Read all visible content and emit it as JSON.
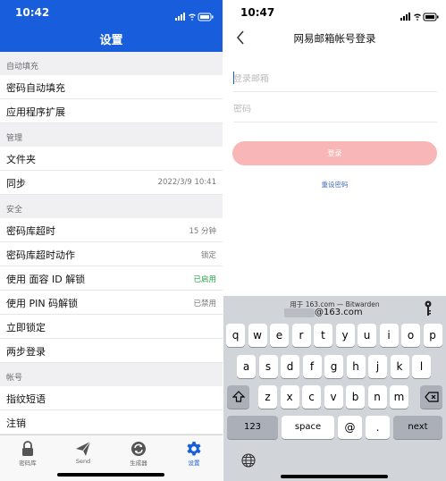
{
  "left_phone": {
    "status_time": "10:42",
    "title": "设置",
    "sections": [
      {
        "header": "自动填充",
        "rows": [
          {
            "label": "密码自动填充",
            "value": ""
          },
          {
            "label": "应用程序扩展",
            "value": ""
          }
        ]
      },
      {
        "header": "管理",
        "rows": [
          {
            "label": "文件夹",
            "value": ""
          },
          {
            "label": "同步",
            "value": "2022/3/9 10:41"
          }
        ]
      },
      {
        "header": "安全",
        "rows": [
          {
            "label": "密码库超时",
            "value": "15 分钟"
          },
          {
            "label": "密码库超时动作",
            "value": "锁定"
          },
          {
            "label": "使用 面容 ID 解锁",
            "value": "已启用"
          },
          {
            "label": "使用 PIN 码解锁",
            "value": "已禁用"
          },
          {
            "label": "立即锁定",
            "value": ""
          },
          {
            "label": "两步登录",
            "value": ""
          }
        ]
      },
      {
        "header": "帐号",
        "rows": [
          {
            "label": "指纹短语",
            "value": ""
          },
          {
            "label": "注销",
            "value": ""
          }
        ]
      }
    ],
    "tabs": [
      {
        "label": "密码库",
        "icon": "lock-icon"
      },
      {
        "label": "Send",
        "icon": "send-icon"
      },
      {
        "label": "生成器",
        "icon": "refresh-icon"
      },
      {
        "label": "设置",
        "icon": "gear-icon"
      }
    ],
    "accent_color": "#175ddc",
    "enabled_color": "#2aa04a"
  },
  "right_phone": {
    "status_time": "10:47",
    "title": "网易邮箱帐号登录",
    "email_placeholder": "登录邮箱",
    "password_placeholder": "密码",
    "login_button": "登录",
    "reset_link": "重设密码",
    "login_button_color": "#f9b6b6",
    "keyboard": {
      "suggestion_source": "用于 163.com — Bitwarden",
      "suggestion_value": "@163.com",
      "row1": [
        "q",
        "w",
        "e",
        "r",
        "t",
        "y",
        "u",
        "i",
        "o",
        "p"
      ],
      "row2": [
        "a",
        "s",
        "d",
        "f",
        "g",
        "h",
        "j",
        "k",
        "l"
      ],
      "row3": [
        "z",
        "x",
        "c",
        "v",
        "b",
        "n",
        "m"
      ],
      "num_key": "123",
      "space_key": "space",
      "at_key": "@",
      "dot_key": ".",
      "next_key": "next"
    }
  }
}
